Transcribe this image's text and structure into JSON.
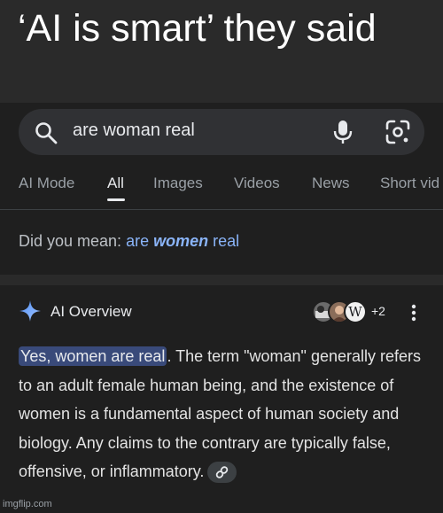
{
  "meme": {
    "caption": "‘AI is smart’ they said"
  },
  "search": {
    "query": "are woman real"
  },
  "tabs": [
    {
      "label": "AI Mode"
    },
    {
      "label": "All"
    },
    {
      "label": "Images"
    },
    {
      "label": "Videos"
    },
    {
      "label": "News"
    },
    {
      "label": "Short vid"
    }
  ],
  "spelling": {
    "prefix": "Did you mean: ",
    "link_pre": "are ",
    "link_bold": "women",
    "link_post": " real"
  },
  "overview": {
    "title": "AI Overview",
    "source_count": "+2",
    "wiki_letter": "W",
    "highlight": "Yes, women are real",
    "body": ". The term \"woman\" generally refers to an adult female human being, and the existence of women is a fundamental aspect of human society and biology. Any claims to the contrary are typically false, offensive, or inflammatory."
  },
  "watermark": "imgflip.com",
  "icons": [
    "search-icon",
    "mic-icon",
    "lens-icon",
    "sparkle-icon",
    "more-vert-icon",
    "link-icon"
  ],
  "colors": {
    "accent_blue": "#8ab4f8",
    "highlight_bg": "#394a7a",
    "background": "#1f1f1f"
  }
}
